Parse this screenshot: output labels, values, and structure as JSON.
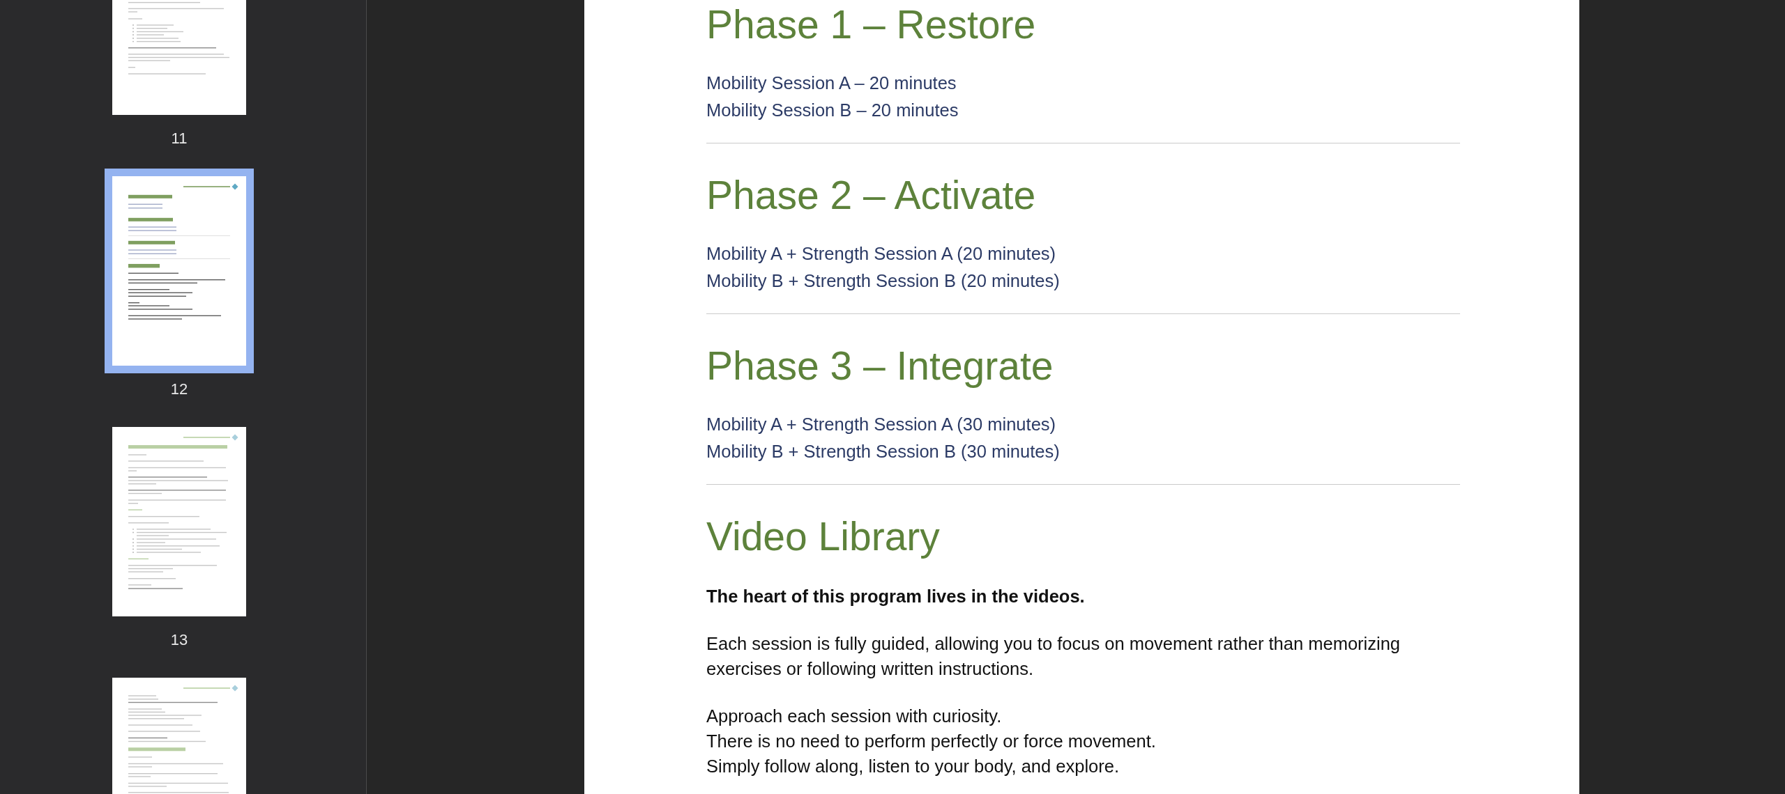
{
  "sidebar": {
    "pages": [
      {
        "label": "11",
        "selected": false
      },
      {
        "label": "12",
        "selected": true
      },
      {
        "label": "13",
        "selected": false
      },
      {
        "selected": false
      }
    ]
  },
  "document": {
    "sections": [
      {
        "heading": "Phase 1 – Restore",
        "sessions": [
          "Mobility Session A – 20 minutes",
          "Mobility Session B – 20 minutes"
        ]
      },
      {
        "heading": "Phase 2 – Activate",
        "sessions": [
          "Mobility A + Strength Session A (20 minutes)",
          "Mobility B + Strength Session B (20 minutes)"
        ]
      },
      {
        "heading": "Phase 3 – Integrate",
        "sessions": [
          "Mobility A + Strength Session A (30 minutes)",
          "Mobility B + Strength Session B (30 minutes)"
        ]
      },
      {
        "heading": "Video Library",
        "paragraphs": [
          {
            "kind": "lead",
            "lines": [
              "The heart of this program lives in the videos."
            ]
          },
          {
            "kind": "plain",
            "lines": [
              "Each session is fully guided, allowing you to focus on movement rather than memorizing exercises or following written instructions."
            ]
          },
          {
            "kind": "plain",
            "lines": [
              "Approach each session with curiosity.",
              "There is no need to perform perfectly or force movement.",
              "Simply follow along, listen to your body, and explore."
            ]
          }
        ]
      }
    ]
  }
}
